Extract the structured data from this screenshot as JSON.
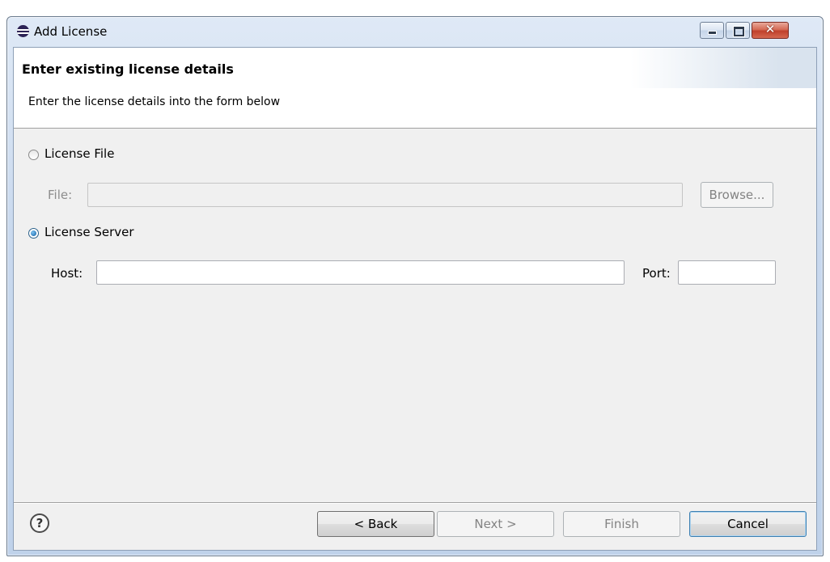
{
  "window": {
    "title": "Add License",
    "close_glyph": "✕"
  },
  "header": {
    "title": "Enter existing license details",
    "description": "Enter the license details into the form below"
  },
  "license_file": {
    "radio_label": "License File",
    "selected": false,
    "file_label": "File:",
    "file_value": "",
    "browse_label": "Browse..."
  },
  "license_server": {
    "radio_label": "License Server",
    "selected": true,
    "host_label": "Host:",
    "host_value": "",
    "port_label": "Port:",
    "port_value": ""
  },
  "footer": {
    "help_glyph": "?",
    "back_label": "< Back",
    "next_label": "Next >",
    "finish_label": "Finish",
    "cancel_label": "Cancel"
  }
}
